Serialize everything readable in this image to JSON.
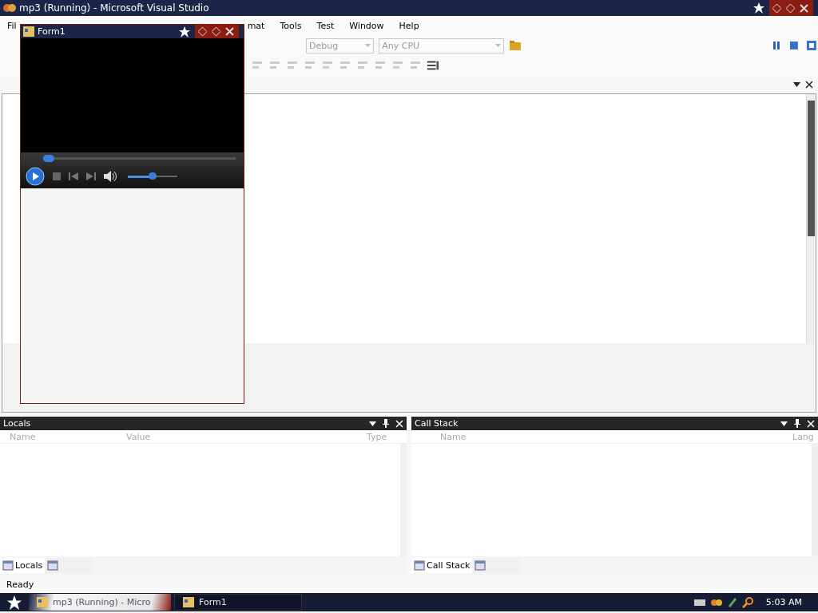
{
  "window": {
    "title": "mp3 (Running) - Microsoft Visual Studio"
  },
  "menu": [
    {
      "label": "Fil"
    },
    {
      "label": "mat"
    },
    {
      "label": "Tools"
    },
    {
      "label": "Test"
    },
    {
      "label": "Window"
    },
    {
      "label": "Help"
    }
  ],
  "toolbar": {
    "configuration": "Debug",
    "platform": "Any CPU"
  },
  "form_window": {
    "title": "Form1",
    "seek": {
      "level": 0.03
    },
    "volume": {
      "level": 0.5
    }
  },
  "panes": [
    {
      "title": "Locals",
      "columns": [
        "Name",
        "Value",
        "Type"
      ],
      "tabs": [
        {
          "label": "Locals",
          "selected": true
        },
        {
          "selected": false
        }
      ]
    },
    {
      "title": "Call Stack",
      "columns": [
        "Name",
        "Lang"
      ],
      "tabs": [
        {
          "label": "Call Stack",
          "selected": true
        },
        {
          "selected": false
        }
      ]
    }
  ],
  "status_bar": "Ready",
  "taskbar": {
    "tasks": [
      {
        "label": "mp3 (Running) - Micro",
        "selected": false
      },
      {
        "label": "Form1",
        "selected": true
      }
    ],
    "clock": "5:03 AM"
  }
}
